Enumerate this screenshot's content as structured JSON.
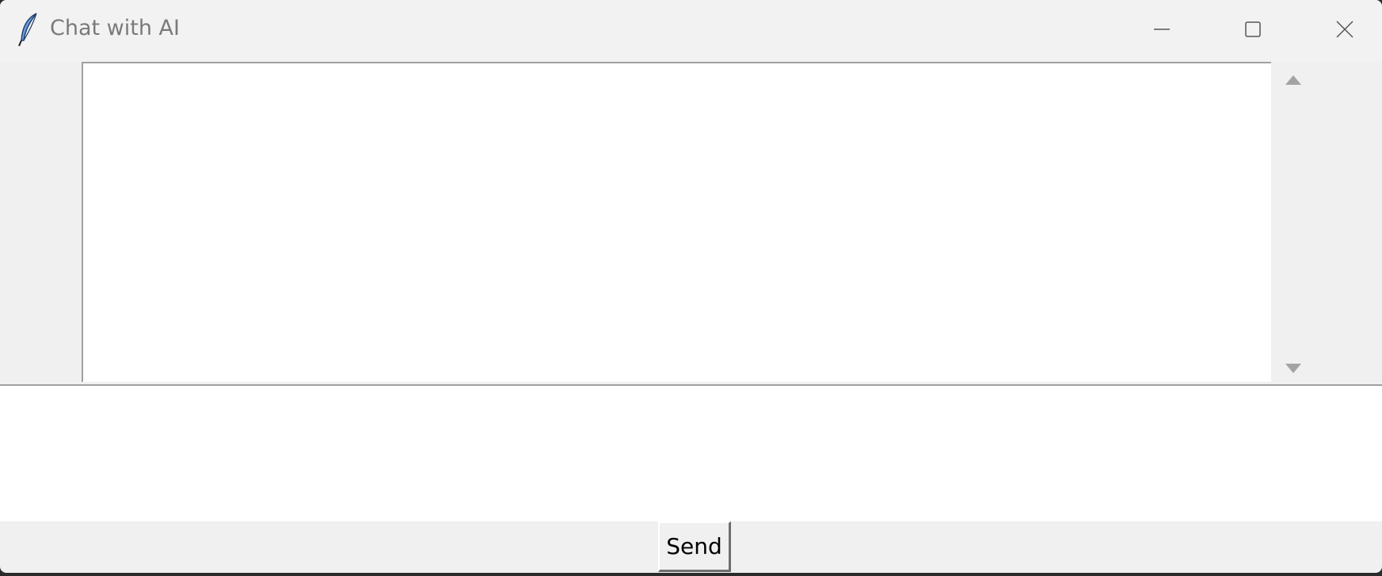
{
  "window": {
    "title": "Chat with AI",
    "app_icon": "feather-icon",
    "controls": {
      "minimize_icon": "minimize-icon",
      "maximize_icon": "maximize-icon",
      "close_icon": "close-icon"
    }
  },
  "chat_log": {
    "content": ""
  },
  "message_input": {
    "value": ""
  },
  "send_button": {
    "label": "Send"
  },
  "colors": {
    "titlebar_bg": "#f2f2f2",
    "window_bg": "#f0f0f0",
    "text_area_bg": "#ffffff",
    "title_text": "#7a7a7a",
    "scroll_arrow": "#a0a0a0"
  }
}
